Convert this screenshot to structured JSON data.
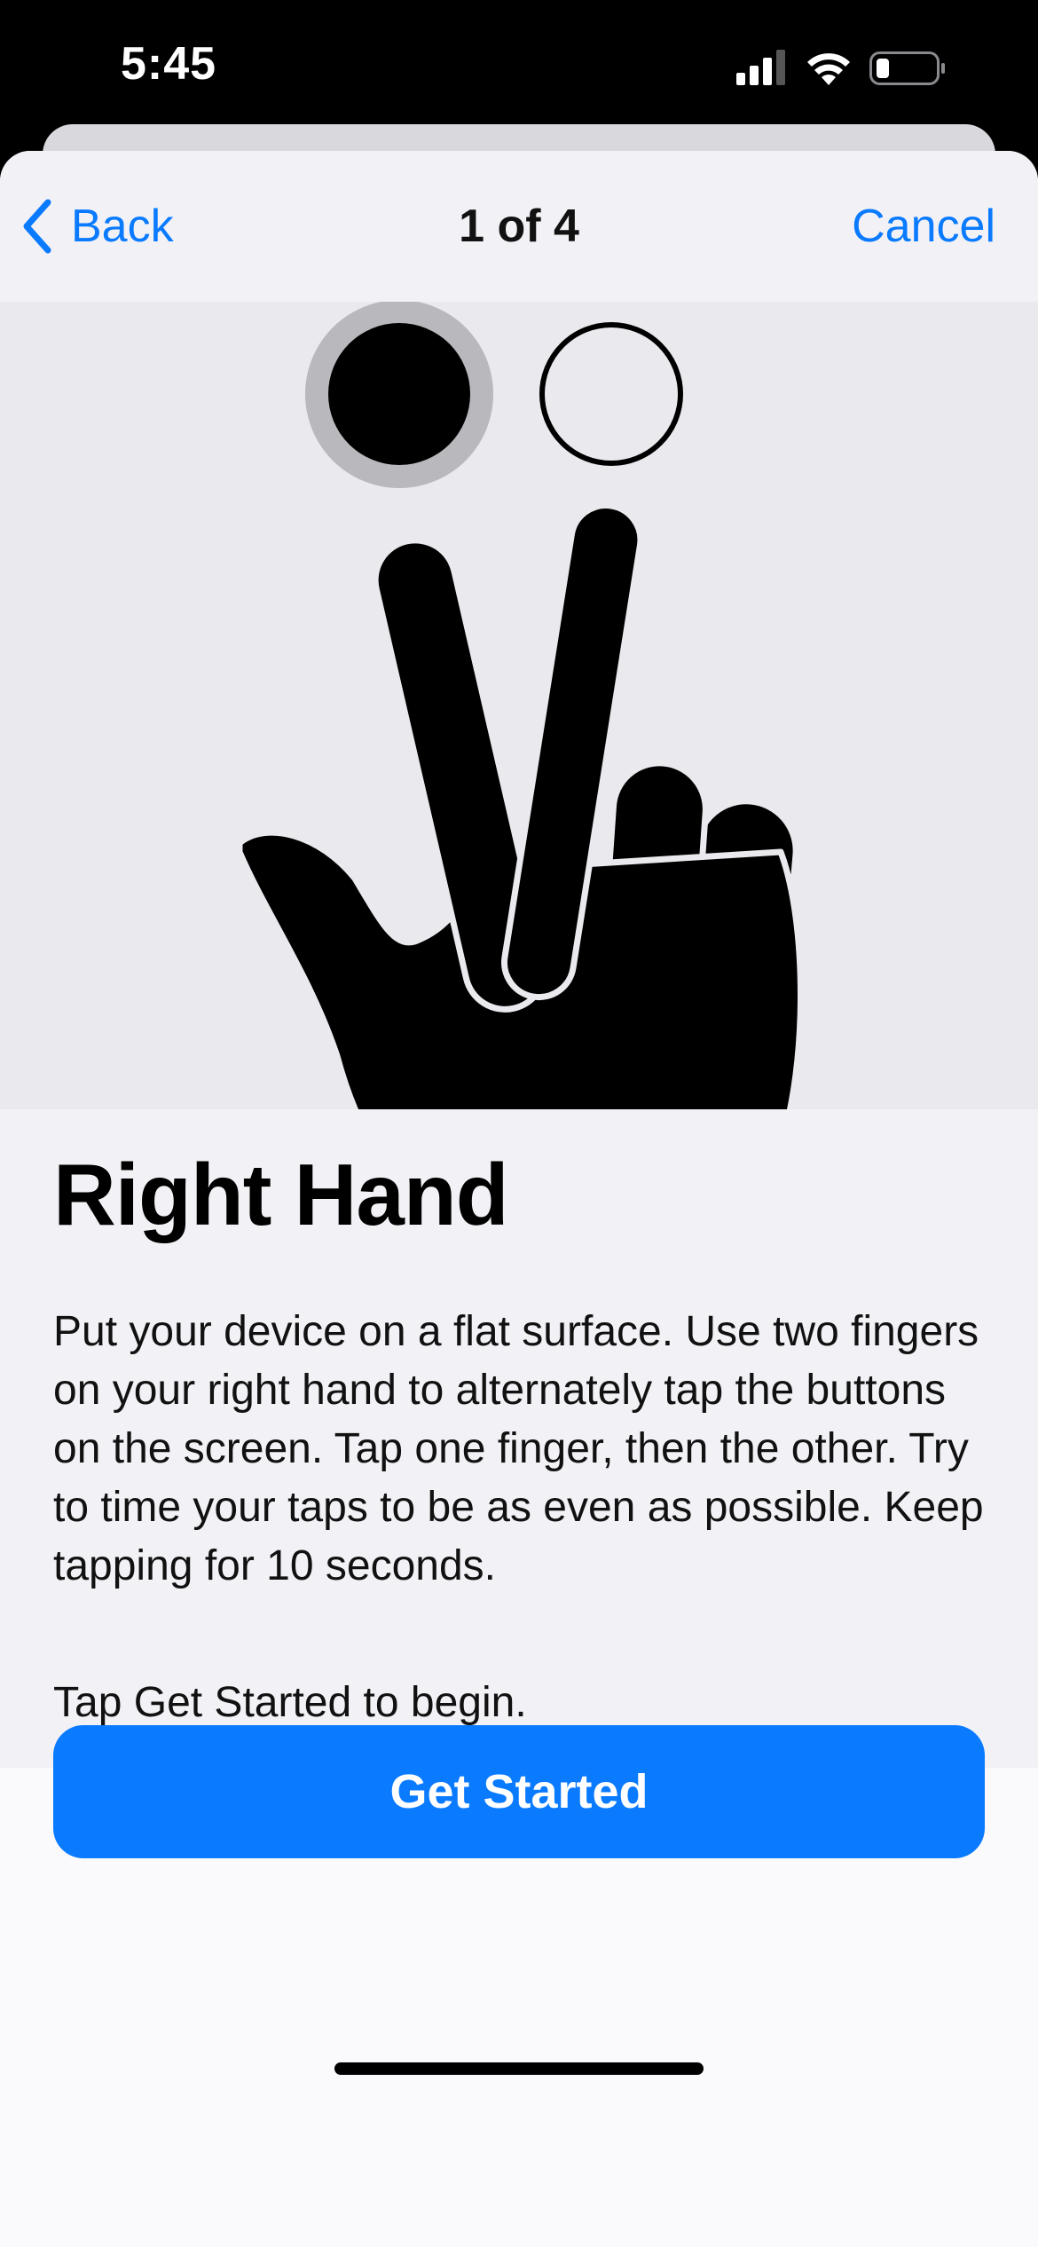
{
  "status_bar": {
    "time": "5:45",
    "icons": [
      "cellular-signal-icon",
      "wifi-icon",
      "battery-icon"
    ]
  },
  "nav": {
    "back_label": "Back",
    "title": "1 of 4",
    "cancel_label": "Cancel"
  },
  "illustration": {
    "icon": "two-finger-tap-hand-icon"
  },
  "content": {
    "title": "Right Hand",
    "description": "Put your device on a flat surface. Use two fingers on your right hand to alternately tap the buttons on the screen. Tap one finger, then the other. Try to time your taps to be as even as possible. Keep tapping for 10 seconds.",
    "hint": "Tap Get Started to begin."
  },
  "actions": {
    "primary_label": "Get Started"
  },
  "colors": {
    "accent": "#0a7aff",
    "background": "#f2f2f6",
    "illustration_bg": "#e9e9ee"
  }
}
